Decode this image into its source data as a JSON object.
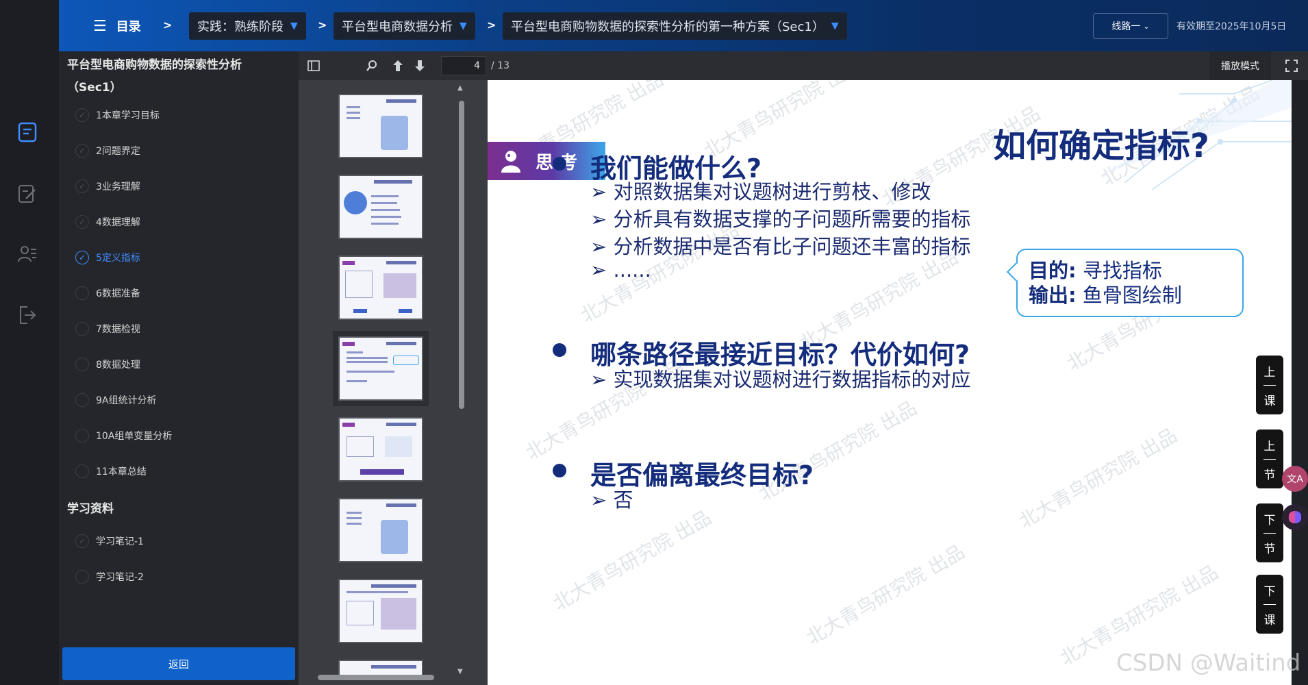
{
  "topbar": {
    "toc_label": "目录",
    "breadcrumbs": [
      "实践：熟练阶段",
      "平台型电商数据分析",
      "平台型电商购物数据的探索性分析的第一种方案（Sec1）"
    ],
    "separator": ">",
    "line_button": "线路一",
    "valid_until": "有效期至2025年10月5日"
  },
  "sidebar": {
    "course_title": "平台型电商购物数据的探索性分析（Sec1）",
    "chapters": [
      {
        "label": "1本章学习目标",
        "active": false
      },
      {
        "label": "2问题界定",
        "active": false
      },
      {
        "label": "3业务理解",
        "active": false
      },
      {
        "label": "4数据理解",
        "active": false
      },
      {
        "label": "5定义指标",
        "active": true
      },
      {
        "label": "6数据准备",
        "active": false
      },
      {
        "label": "7数据检视",
        "active": false
      },
      {
        "label": "8数据处理",
        "active": false
      },
      {
        "label": "9A组统计分析",
        "active": false
      },
      {
        "label": "10A组单变量分析",
        "active": false
      },
      {
        "label": "11本章总结",
        "active": false
      }
    ],
    "materials_title": "学习资料",
    "materials": [
      {
        "label": "学习笔记-1"
      },
      {
        "label": "学习笔记-2"
      }
    ],
    "back_button": "返回"
  },
  "viewer": {
    "current_page": "4",
    "total_pages": "/ 13",
    "play_mode": "播放模式"
  },
  "slide": {
    "title": "如何确定指标?",
    "think_tag": "思 考",
    "q1": "我们能做什么?",
    "q1_items": [
      "➢ 对照数据集对议题树进行剪枝、修改",
      "➢ 分析具有数据支撑的子问题所需要的指标",
      "➢ 分析数据中是否有比子问题还丰富的指标",
      "➢ ......"
    ],
    "callout": {
      "purpose_label": "目的:",
      "purpose": "寻找指标",
      "output_label": "输出:",
      "output": "鱼骨图绘制"
    },
    "q2": "哪条路径最接近目标？代价如何?",
    "q2_items": [
      "➢ 实现数据集对议题树进行数据指标的对应"
    ],
    "q3": "是否偏离最终目标?",
    "q3_items": [
      "➢ 否"
    ],
    "watermark": "北大青鸟研究院 出品",
    "nav": {
      "prev_lesson": [
        "上",
        "课"
      ],
      "prev_section": [
        "上",
        "节"
      ],
      "next_section": [
        "下",
        "节"
      ],
      "next_lesson": [
        "下",
        "课"
      ]
    }
  },
  "overlay": {
    "csdn": "CSDN @Waitind"
  },
  "colors": {
    "brand_blue": "#0f62c9",
    "slide_navy": "#142c7c",
    "active_chapter": "#3f8cff"
  }
}
